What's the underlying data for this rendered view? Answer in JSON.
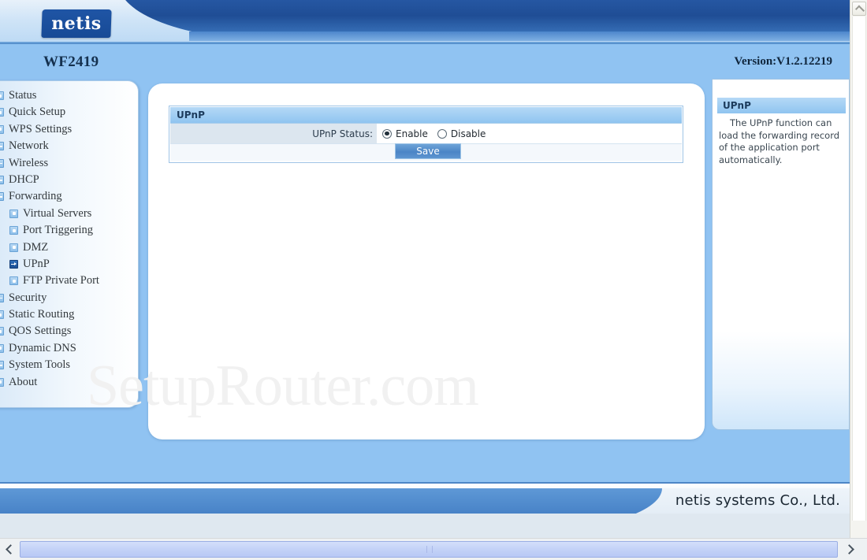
{
  "browser": {
    "vscroll_up_icon": "chevron-up-icon",
    "vscroll_down_icon": "chevron-down-icon",
    "hscroll_left_icon": "chevron-left-icon",
    "hscroll_right_icon": "chevron-right-icon"
  },
  "header": {
    "logo_text": "netis",
    "model": "WF2419",
    "version": "Version:V1.2.12219"
  },
  "sidebar": {
    "items": [
      {
        "label": "Status",
        "icon": "page-icon",
        "level": 0,
        "state": "leaf"
      },
      {
        "label": "Quick Setup",
        "icon": "page-icon",
        "level": 0,
        "state": "leaf"
      },
      {
        "label": "WPS Settings",
        "icon": "page-icon",
        "level": 0,
        "state": "leaf"
      },
      {
        "label": "Network",
        "icon": "plus-icon",
        "level": 0,
        "state": "collapsed"
      },
      {
        "label": "Wireless",
        "icon": "plus-icon",
        "level": 0,
        "state": "collapsed"
      },
      {
        "label": "DHCP",
        "icon": "plus-icon",
        "level": 0,
        "state": "collapsed"
      },
      {
        "label": "Forwarding",
        "icon": "minus-icon",
        "level": 0,
        "state": "expanded"
      },
      {
        "label": "Virtual Servers",
        "icon": "page-icon",
        "level": 1,
        "state": "leaf"
      },
      {
        "label": "Port Triggering",
        "icon": "page-icon",
        "level": 1,
        "state": "leaf"
      },
      {
        "label": "DMZ",
        "icon": "page-icon",
        "level": 1,
        "state": "leaf"
      },
      {
        "label": "UPnP",
        "icon": "arrow-icon",
        "level": 1,
        "state": "current"
      },
      {
        "label": "FTP Private Port",
        "icon": "page-icon",
        "level": 1,
        "state": "leaf"
      },
      {
        "label": "Security",
        "icon": "plus-icon",
        "level": 0,
        "state": "collapsed"
      },
      {
        "label": "Static Routing",
        "icon": "page-icon",
        "level": 0,
        "state": "leaf"
      },
      {
        "label": "QOS Settings",
        "icon": "page-icon",
        "level": 0,
        "state": "leaf"
      },
      {
        "label": "Dynamic DNS",
        "icon": "page-icon",
        "level": 0,
        "state": "leaf"
      },
      {
        "label": "System Tools",
        "icon": "plus-icon",
        "level": 0,
        "state": "collapsed"
      },
      {
        "label": "About",
        "icon": "page-icon",
        "level": 0,
        "state": "leaf"
      }
    ]
  },
  "main": {
    "form_title": "UPnP",
    "status_label": "UPnP Status:",
    "radio_options": [
      {
        "label": "Enable",
        "selected": true
      },
      {
        "label": "Disable",
        "selected": false
      }
    ],
    "save_label": "Save",
    "watermark": "SetupRouter.com"
  },
  "help": {
    "title": "UPnP",
    "text": "The UPnP function can load the forwarding record of the application port automatically."
  },
  "footer": {
    "company": "netis systems Co., Ltd."
  },
  "colors": {
    "brand_blue": "#1f55a5",
    "band_blue": "#90c3f2",
    "panel_white": "#ffffff",
    "accent": "#4b85c6"
  }
}
